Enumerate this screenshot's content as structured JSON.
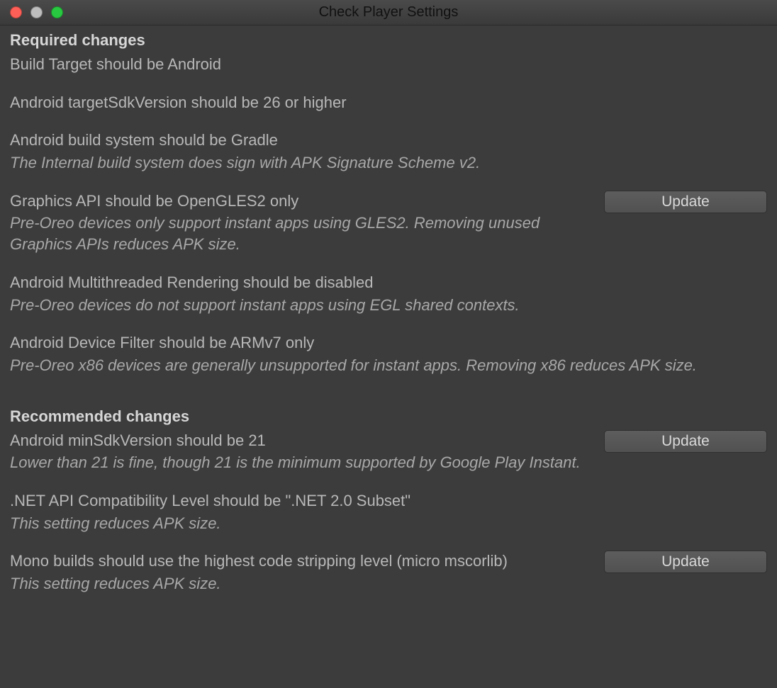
{
  "window": {
    "title": "Check Player Settings"
  },
  "labels": {
    "update": "Update"
  },
  "sections": {
    "required": {
      "heading": "Required changes",
      "items": [
        {
          "id": "build-target",
          "main": "Build Target should be Android",
          "note": "",
          "hasUpdate": false
        },
        {
          "id": "target-sdk",
          "main": "Android targetSdkVersion should be 26 or higher",
          "note": "",
          "hasUpdate": false
        },
        {
          "id": "build-system",
          "main": "Android build system should be Gradle",
          "note": "The Internal build system does sign with APK Signature Scheme v2.",
          "hasUpdate": false
        },
        {
          "id": "graphics-api",
          "main": "Graphics API should be OpenGLES2 only",
          "note": "Pre-Oreo devices only support instant apps using GLES2. Removing unused Graphics APIs reduces APK size.",
          "hasUpdate": true
        },
        {
          "id": "multithreaded",
          "main": "Android Multithreaded Rendering should be disabled",
          "note": "Pre-Oreo devices do not support instant apps using EGL shared contexts.",
          "hasUpdate": false
        },
        {
          "id": "device-filter",
          "main": "Android Device Filter should be ARMv7 only",
          "note": "Pre-Oreo x86 devices are generally unsupported for instant apps. Removing x86 reduces APK size.",
          "hasUpdate": false
        }
      ]
    },
    "recommended": {
      "heading": "Recommended changes",
      "items": [
        {
          "id": "min-sdk",
          "main": "Android minSdkVersion should be 21",
          "note": "Lower than 21 is fine, though 21 is the minimum supported by Google Play Instant.",
          "hasUpdate": true
        },
        {
          "id": "net-api",
          "main": ".NET API Compatibility Level should be \".NET 2.0 Subset\"",
          "note": "This setting reduces APK size.",
          "hasUpdate": false
        },
        {
          "id": "mono-strip",
          "main": "Mono builds should use the highest code stripping level (micro mscorlib)",
          "note": "This setting reduces APK size.",
          "hasUpdate": true
        }
      ]
    }
  }
}
